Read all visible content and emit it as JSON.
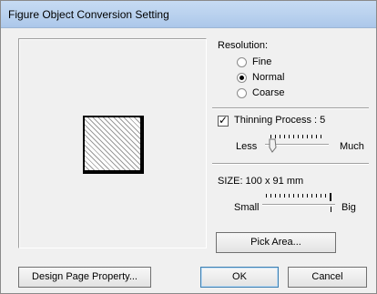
{
  "window": {
    "title": "Figure Object Conversion Setting"
  },
  "resolution": {
    "label": "Resolution:",
    "options": [
      "Fine",
      "Normal",
      "Coarse"
    ],
    "selected": "Normal"
  },
  "thinning": {
    "label": "Thinning Process : 5",
    "checked": true,
    "value": 5,
    "min_label": "Less",
    "max_label": "Much"
  },
  "size": {
    "label": "SIZE:  100 x 91 mm",
    "min_label": "Small",
    "max_label": "Big",
    "slider_level": 1.0
  },
  "buttons": {
    "pick_area": "Pick Area...",
    "design_page_property": "Design Page Property...",
    "ok": "OK",
    "cancel": "Cancel"
  }
}
